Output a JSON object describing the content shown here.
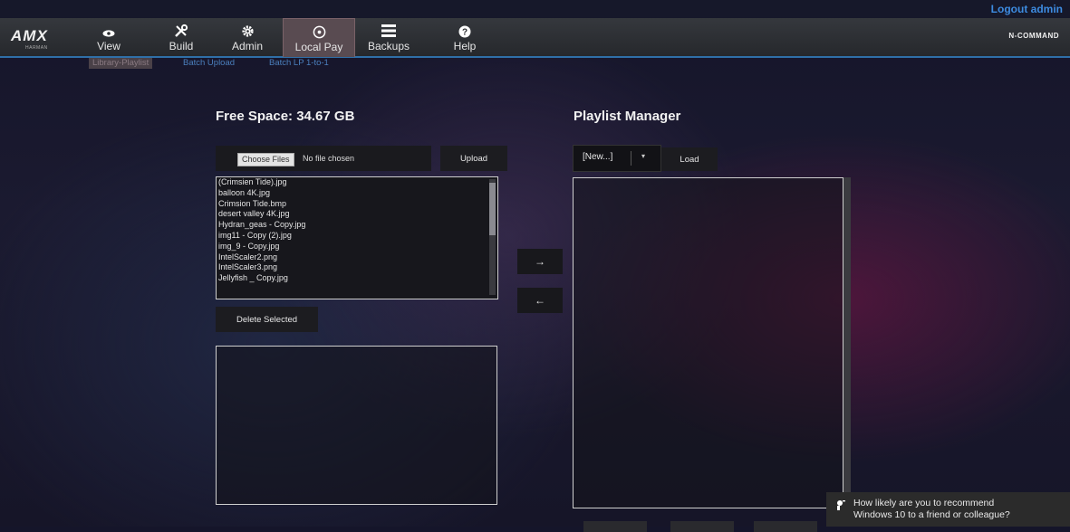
{
  "header": {
    "logo": "AMX",
    "logo_sub": "HARMAN",
    "logout": "Logout admin",
    "brand_right": "N-COMMAND"
  },
  "nav": {
    "items": [
      {
        "label": "View",
        "icon": "eye-icon"
      },
      {
        "label": "Build",
        "icon": "tools-icon"
      },
      {
        "label": "Admin",
        "icon": "gear-icon"
      },
      {
        "label": "Local Pay",
        "icon": "play-circle-icon",
        "active": true
      },
      {
        "label": "Backups",
        "icon": "menu-icon"
      },
      {
        "label": "Help",
        "icon": "help-icon"
      }
    ]
  },
  "subnav": {
    "items": [
      {
        "label": "Library-Playlist",
        "active": true
      },
      {
        "label": "Batch Upload"
      },
      {
        "label": "Batch LP 1-to-1"
      }
    ]
  },
  "library": {
    "title": "Free Space: 34.67 GB",
    "choose_files": "Choose Files",
    "no_file": "No file chosen",
    "upload": "Upload",
    "files": [
      "(Crimsien Tide).jpg",
      "balloon 4K.jpg",
      "Crimsion Tide.bmp",
      "desert valley 4K.jpg",
      "Hydran_geas - Copy.jpg",
      "img11 - Copy (2).jpg",
      "img_9 - Copy.jpg",
      "IntelScaler2.png",
      "IntelScaler3.png",
      "Jellyfish _ Copy.jpg"
    ],
    "delete_selected": "Delete Selected"
  },
  "transfer": {
    "add": "→",
    "remove": "←"
  },
  "playlist": {
    "title": "Playlist Manager",
    "selected": "[New...]",
    "load": "Load"
  },
  "toast": {
    "line1": "How likely are you to recommend",
    "line2": "Windows 10 to a friend or colleague?"
  }
}
